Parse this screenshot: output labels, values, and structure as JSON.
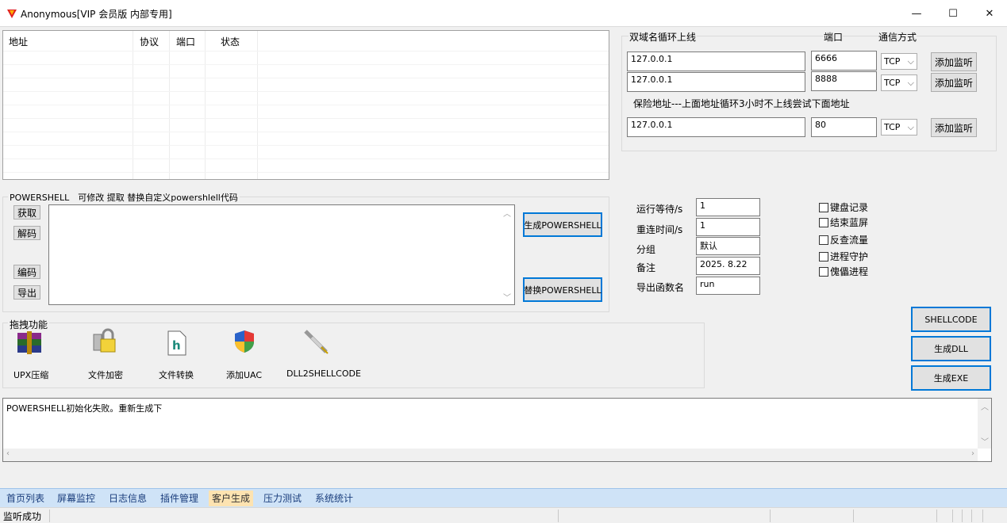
{
  "window": {
    "title": "Anonymous[VIP 会员版 内部专用]",
    "minimize": "—",
    "maximize": "☐",
    "close": "✕"
  },
  "table": {
    "columns": [
      "地址",
      "协议",
      "端口",
      "状态"
    ]
  },
  "servers": {
    "title": "双域名循环上线",
    "port_header": "端口",
    "mode_header": "通信方式",
    "rows": [
      {
        "host": "127.0.0.1",
        "port": "6666",
        "mode": "TCP",
        "button": "添加监听"
      },
      {
        "host": "127.0.0.1",
        "port": "8888",
        "mode": "TCP",
        "button": "添加监听"
      }
    ],
    "backup_note": "保险地址---上面地址循环3小时不上线尝试下面地址",
    "backup": {
      "host": "127.0.0.1",
      "port": "80",
      "mode": "TCP",
      "button": "添加监听"
    }
  },
  "powershell": {
    "header": "POWERSHELL　可修改 提取 替换自定义powershlell代码",
    "get_btn": "获取",
    "decode_btn": "解码",
    "encode_btn": "编码",
    "export_btn": "导出",
    "generate_btn": "生成POWERSHELL",
    "replace_btn": "替换POWERSHELL",
    "content": ""
  },
  "settings": {
    "wait_label": "运行等待/s",
    "wait_value": "1",
    "reconnect_label": "重连时间/s",
    "reconnect_value": "1",
    "group_label": "分组",
    "group_value": "默认",
    "note_label": "备注",
    "note_value": "2025. 8.22",
    "export_label": "导出函数名",
    "export_value": "run"
  },
  "options": [
    {
      "label": "键盘记录",
      "checked": false
    },
    {
      "label": "结束蓝屏",
      "checked": false
    },
    {
      "label": "反查流量",
      "checked": false
    },
    {
      "label": "进程守护",
      "checked": false
    },
    {
      "label": "傀儡进程",
      "checked": false
    }
  ],
  "drag": {
    "title": "拖拽功能",
    "tools": [
      {
        "label": "UPX压缩",
        "icon": "winrar-icon"
      },
      {
        "label": "文件加密",
        "icon": "lock-icon"
      },
      {
        "label": "文件转换",
        "icon": "h-file-icon"
      },
      {
        "label": "添加UAC",
        "icon": "uac-shield-icon"
      },
      {
        "label": "DLL2SHELLCODE",
        "icon": "syringe-icon"
      }
    ]
  },
  "build": {
    "shellcode_btn": "SHELLCODE",
    "dll_btn": "生成DLL",
    "exe_btn": "生成EXE"
  },
  "log": {
    "text": "POWERSHELL初始化失败。重新生成下"
  },
  "tabs": [
    "首页列表",
    "屏幕监控",
    "日志信息",
    "插件管理",
    "客户生成",
    "压力测试",
    "系统统计"
  ],
  "active_tab": "客户生成",
  "status": {
    "text": "监听成功"
  },
  "colors": {
    "accent": "#0078d7",
    "tabbar": "#cfe3f7",
    "active_tab": "#fde3b1",
    "tab_text": "#1a3d7c"
  }
}
